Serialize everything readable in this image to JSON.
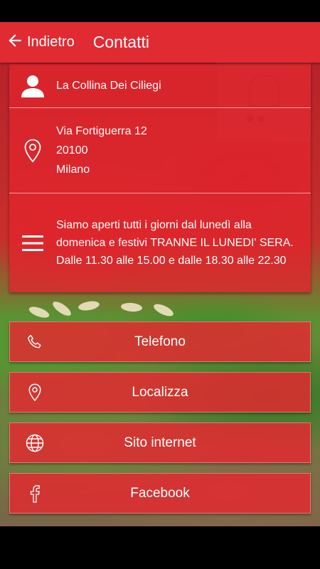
{
  "header": {
    "back_label": "Indietro",
    "title": "Contatti",
    "color": "#e02b33"
  },
  "info": {
    "name": "La Collina Dei Ciliegi",
    "address": [
      "Via Fortiguerra 12",
      "20100",
      "Milano"
    ],
    "hours": "Siamo aperti tutti i giorni dal lunedì alla domenica e festivi TRANNE IL LUNEDI' SERA. Dalle 11.30 alle 15.00 e dalle 18.30 alle 22.30",
    "icons": [
      "person-icon",
      "location-pin-icon",
      "menu-lines-icon"
    ]
  },
  "buttons": [
    {
      "label": "Telefono",
      "icon": "phone-icon"
    },
    {
      "label": "Localizza",
      "icon": "location-pin-icon"
    },
    {
      "label": "Sito internet",
      "icon": "globe-icon"
    },
    {
      "label": "Facebook",
      "icon": "facebook-icon"
    }
  ]
}
